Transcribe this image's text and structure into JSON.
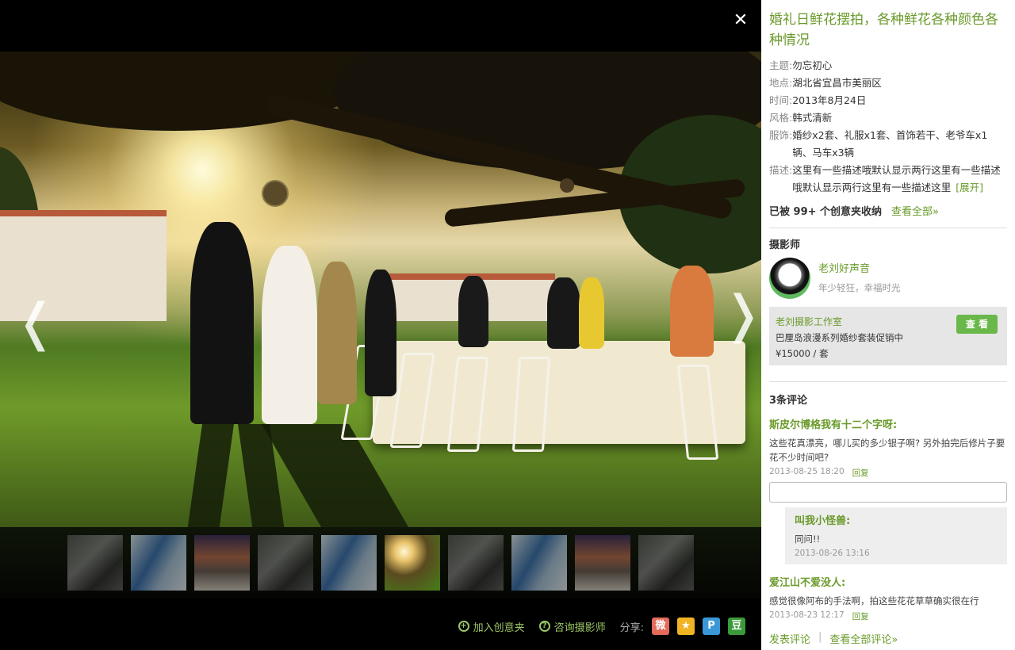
{
  "viewer": {
    "close_symbol": "✕",
    "prev_symbol": "❬",
    "next_symbol": "❭",
    "thumbnails": [
      "gray",
      "blue",
      "sunset",
      "gray",
      "blue",
      "active",
      "gray",
      "blue",
      "sunset",
      "gray"
    ],
    "footer": {
      "add_label": "加入创意夹",
      "consult_label": "咨询摄影师",
      "share_label": "分享:",
      "share_icons": [
        {
          "name": "weibo-icon",
          "glyph": "微",
          "color": "#e46a5a"
        },
        {
          "name": "qzone-icon",
          "glyph": "★",
          "color": "#f0b323"
        },
        {
          "name": "pengyou-icon",
          "glyph": "P",
          "color": "#3a98d8"
        },
        {
          "name": "douban-icon",
          "glyph": "豆",
          "color": "#3a9a3a"
        }
      ]
    }
  },
  "panel": {
    "title": "婚礼日鲜花摆拍，各种鲜花各种颜色各种情况",
    "meta": [
      {
        "key": "主题:",
        "val": "勿忘初心"
      },
      {
        "key": "地点:",
        "val": "湖北省宜昌市美丽区"
      },
      {
        "key": "时间:",
        "val": "2013年8月24日"
      },
      {
        "key": "风格:",
        "val": "韩式清新"
      },
      {
        "key": "服饰:",
        "val": "婚纱x2套、礼服x1套、首饰若干、老爷车x1辆、马车x3辆"
      },
      {
        "key": "描述:",
        "val": "这里有一些描述哦默认显示两行这里有一些描述哦默认显示两行这里有一些描述这里"
      }
    ],
    "expand_label": "[展开]",
    "collect_text": "已被 99+ 个创意夹收纳",
    "collect_more": "查看全部»",
    "photographer_heading": "摄影师",
    "photographer_name": "老刘好声音",
    "photographer_tagline": "年少轻狂，幸福时光",
    "studio": {
      "name": "老刘摄影工作室",
      "promo": "巴厘岛浪漫系列婚纱套装促销中",
      "price": "¥15000 / 套",
      "button": "查 看"
    },
    "comments_heading": "3条评论",
    "comments": [
      {
        "author": "斯皮尔博格我有十二个字呀:",
        "text": "这些花真漂亮，哪儿买的多少银子啊? 另外拍完后修片子要花不少时间吧?",
        "time": "2013-08-25 18:20",
        "reply": "回复"
      },
      {
        "author": "爱江山不爱没人:",
        "text": "感觉很像阿布的手法啊，拍这些花花草草确实很在行",
        "time": "2013-08-23 12:17",
        "reply": "回复"
      }
    ],
    "sub_reply": {
      "author": "叫我小怪兽:",
      "text": "同问!!",
      "time": "2013-08-26 13:16"
    },
    "footer_post": "发表评论",
    "footer_sep": "|",
    "footer_all": "查看全部评论»"
  }
}
